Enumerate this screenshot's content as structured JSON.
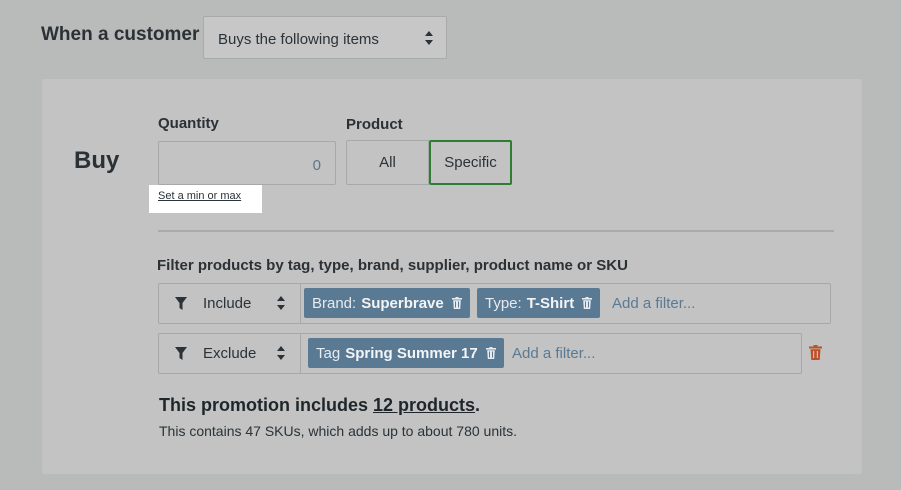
{
  "trigger": {
    "label": "When a customer",
    "selected": "Buys the following items"
  },
  "buy": {
    "heading": "Buy",
    "quantity_label": "Quantity",
    "quantity_value": "0",
    "minmax_link": "Set a min or max",
    "product_label": "Product",
    "product_options": [
      "All",
      "Specific"
    ],
    "product_selected": "Specific"
  },
  "filters": {
    "heading": "Filter products by tag, type, brand, supplier, product name or SKU",
    "include": {
      "mode": "Include",
      "tags": [
        {
          "key": "Brand:",
          "value": "Superbrave"
        },
        {
          "key": "Type:",
          "value": "T-Shirt"
        }
      ],
      "add_placeholder": "Add a filter..."
    },
    "exclude": {
      "mode": "Exclude",
      "tags": [
        {
          "key": "Tag",
          "value": "Spring Summer 17"
        }
      ],
      "add_placeholder": "Add a filter..."
    }
  },
  "summary": {
    "prefix": "This promotion includes ",
    "link": "12 products",
    "suffix": ".",
    "detail": "This contains 47 SKUs, which adds up to about 780 units."
  },
  "colors": {
    "accent_green": "#2e7d32",
    "tag_blue": "#5a7a94",
    "danger": "#c0502a"
  },
  "icons": {
    "filter": "funnel-icon",
    "stepper": "updown-arrows-icon",
    "remove": "trash-icon"
  }
}
